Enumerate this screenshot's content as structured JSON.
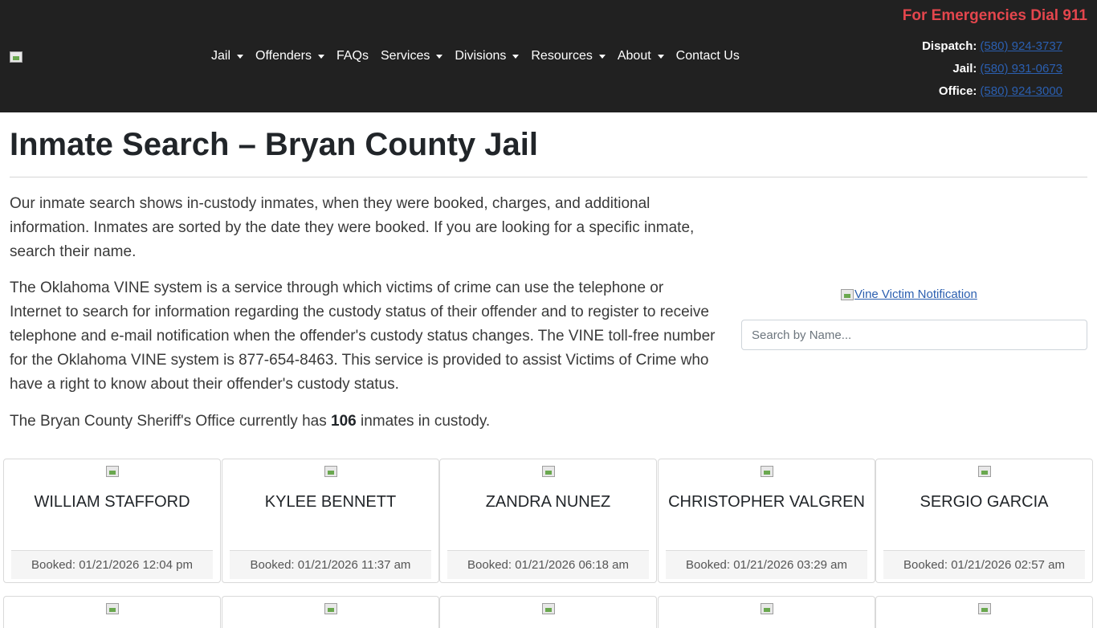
{
  "header": {
    "nav": [
      {
        "label": "Jail",
        "dropdown": true
      },
      {
        "label": "Offenders",
        "dropdown": true
      },
      {
        "label": "FAQs",
        "dropdown": false
      },
      {
        "label": "Services",
        "dropdown": true
      },
      {
        "label": "Divisions",
        "dropdown": true
      },
      {
        "label": "Resources",
        "dropdown": true
      },
      {
        "label": "About",
        "dropdown": true
      },
      {
        "label": "Contact Us",
        "dropdown": false
      }
    ],
    "emergency": "For Emergencies Dial 911",
    "contacts": [
      {
        "label": "Dispatch:",
        "phone": "(580) 924-3737"
      },
      {
        "label": "Jail:",
        "phone": "(580) 931-0673"
      },
      {
        "label": "Office:",
        "phone": "(580) 924-3000"
      }
    ]
  },
  "main": {
    "title": "Inmate Search – Bryan County Jail",
    "paragraph1": "Our inmate search shows in-custody inmates, when they were booked, charges, and additional information. Inmates are sorted by the date they were booked. If you are looking for a specific inmate, search their name.",
    "paragraph2": "The Oklahoma VINE system is a service through which victims of crime can use the telephone or Internet to search for information regarding the custody status of their offender and to register to receive telephone and e-mail notification when the offender's custody status changes. The VINE toll-free number for the Oklahoma VINE system is 877-654-8463. This service is provided to assist Victims of Crime who have a right to know about their offender's custody status.",
    "count_prefix": "The Bryan County Sheriff's Office currently has ",
    "count": "106",
    "count_suffix": " inmates in custody.",
    "vine_link": "Vine Victim Notification",
    "search_placeholder": "Search by Name..."
  },
  "inmates": [
    {
      "name": "WILLIAM STAFFORD",
      "booked": "Booked: 01/21/2026 12:04 pm"
    },
    {
      "name": "KYLEE BENNETT",
      "booked": "Booked: 01/21/2026 11:37 am"
    },
    {
      "name": "ZANDRA NUNEZ",
      "booked": "Booked: 01/21/2026 06:18 am"
    },
    {
      "name": "CHRISTOPHER VALGREN",
      "booked": "Booked: 01/21/2026 03:29 am"
    },
    {
      "name": "SERGIO GARCIA",
      "booked": "Booked: 01/21/2026 02:57 am"
    }
  ]
}
